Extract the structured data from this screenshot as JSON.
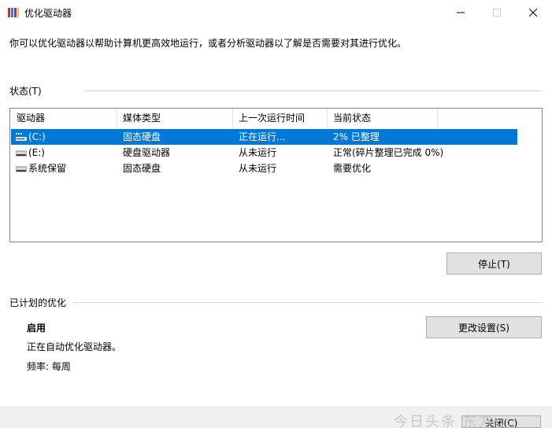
{
  "window": {
    "title": "优化驱动器",
    "controls": {
      "minimize": "minimize-icon",
      "maximize": "maximize-icon",
      "close": "close-icon"
    }
  },
  "description": "你可以优化驱动器以帮助计算机更高效地运行，或者分析驱动器以了解是否需要对其进行优化。",
  "status": {
    "heading": "状态(T)",
    "columns": [
      "驱动器",
      "媒体类型",
      "上一次运行时间",
      "当前状态"
    ],
    "rows": [
      {
        "drive": "(C:)",
        "media": "固态硬盘",
        "last_run": "正在运行...",
        "state": "2% 已整理",
        "selected": true
      },
      {
        "drive": "(E:)",
        "media": "硬盘驱动器",
        "last_run": "从未运行",
        "state": "正常(碎片整理已完成 0%)",
        "selected": false
      },
      {
        "drive": "系统保留",
        "media": "固态硬盘",
        "last_run": "从未运行",
        "state": "需要优化",
        "selected": false
      }
    ],
    "stop_button": "停止(T)"
  },
  "scheduled": {
    "heading": "已计划的优化",
    "state": "启用",
    "detail": "正在自动优化驱动器。",
    "frequency": "频率: 每周",
    "change_button": "更改设置(S)"
  },
  "footer": {
    "close_button_partial": "关闭(C)",
    "watermark": "今日头条 东方..."
  },
  "colors": {
    "selection": "#0078d7",
    "button_face": "#e1e1e1",
    "button_border": "#adadad"
  }
}
